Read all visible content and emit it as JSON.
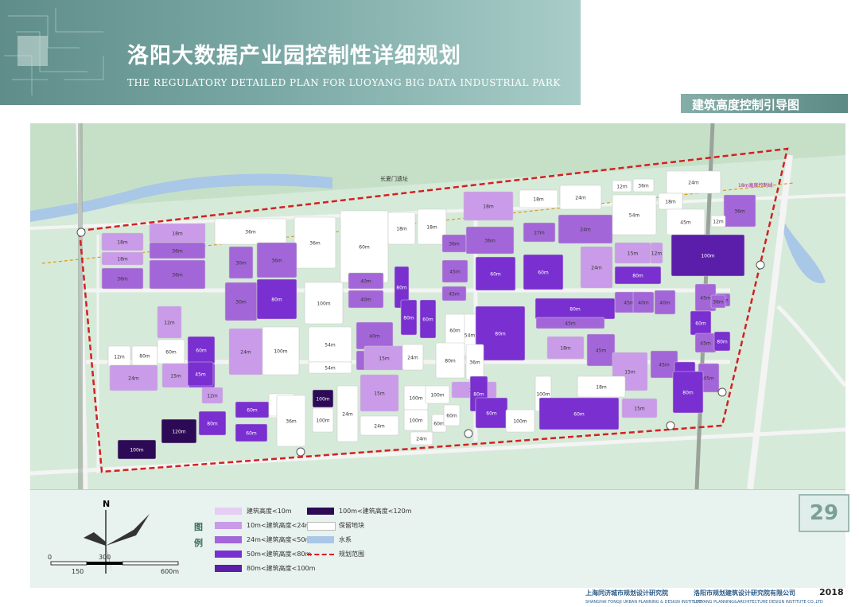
{
  "header": {
    "title_cn": "洛阳大数据产业园控制性详细规划",
    "title_en": "THE REGULATORY DETAILED PLAN FOR LUOYANG BIG DATA INDUSTRIAL PARK",
    "subtitle": "建筑高度控制引导图"
  },
  "map": {
    "road_label": "长夏门遗址",
    "line_label": "18m高度控制线",
    "colors": {
      "background": "#d6ead9",
      "road": "#f2f2f2",
      "water": "#a9c7e6",
      "reserved": "#ffffff",
      "boundary": "#d42020",
      "h1": "#e6cdf4",
      "h2": "#c99be8",
      "h3": "#a366d8",
      "h4": "#7a2fd0",
      "h5": "#5a1eaa",
      "h6": "#2c0a55"
    },
    "blocks": [
      {
        "label": "18m",
        "c": "h2"
      },
      {
        "label": "18m",
        "c": "h2"
      },
      {
        "label": "18m",
        "c": "h2"
      },
      {
        "label": "36m",
        "c": "h3"
      },
      {
        "label": "36m",
        "c": "h3"
      },
      {
        "label": "36m",
        "c": "h3"
      },
      {
        "label": "36m",
        "c": "reserved"
      },
      {
        "label": "60m",
        "c": "reserved"
      },
      {
        "label": "36m",
        "c": "reserved"
      },
      {
        "label": "18m",
        "c": "reserved"
      },
      {
        "label": "18m",
        "c": "reserved"
      },
      {
        "label": "18m",
        "c": "h2"
      },
      {
        "label": "36m",
        "c": "h3"
      },
      {
        "label": "36m",
        "c": "h3"
      },
      {
        "label": "18m",
        "c": "reserved"
      },
      {
        "label": "24m",
        "c": "reserved"
      },
      {
        "label": "27m",
        "c": "h3"
      },
      {
        "label": "24m",
        "c": "h3"
      },
      {
        "label": "12m",
        "c": "reserved"
      },
      {
        "label": "36m",
        "c": "reserved"
      },
      {
        "label": "54m",
        "c": "reserved"
      },
      {
        "label": "24m",
        "c": "reserved"
      },
      {
        "label": "18m",
        "c": "reserved"
      },
      {
        "label": "45m",
        "c": "reserved"
      },
      {
        "label": "36m",
        "c": "h3"
      },
      {
        "label": "12m",
        "c": "reserved"
      },
      {
        "label": "15m",
        "c": "h2"
      },
      {
        "label": "12m",
        "c": "h2"
      },
      {
        "label": "100m",
        "c": "h5"
      },
      {
        "label": "30m",
        "c": "h3"
      },
      {
        "label": "36m",
        "c": "h3"
      },
      {
        "label": "60m",
        "c": "h4"
      },
      {
        "label": "60m",
        "c": "h4"
      },
      {
        "label": "24m",
        "c": "h2"
      },
      {
        "label": "80m",
        "c": "h4"
      },
      {
        "label": "45m",
        "c": "h3"
      },
      {
        "label": "45m",
        "c": "h3"
      },
      {
        "label": "40m",
        "c": "h3"
      },
      {
        "label": "40m",
        "c": "h3"
      },
      {
        "label": "80m",
        "c": "h4"
      },
      {
        "label": "30m",
        "c": "h3"
      },
      {
        "label": "80m",
        "c": "h4"
      },
      {
        "label": "100m",
        "c": "reserved"
      },
      {
        "label": "40m",
        "c": "h3"
      },
      {
        "label": "40m",
        "c": "h3"
      },
      {
        "label": "54m",
        "c": "reserved"
      },
      {
        "label": "12m",
        "c": "h2"
      },
      {
        "label": "80m",
        "c": "h4"
      },
      {
        "label": "60m",
        "c": "reserved"
      },
      {
        "label": "45m",
        "c": "h3"
      },
      {
        "label": "80m",
        "c": "h4"
      },
      {
        "label": "45m",
        "c": "h3"
      },
      {
        "label": "40m",
        "c": "h3"
      },
      {
        "label": "40m",
        "c": "h3"
      },
      {
        "label": "36m",
        "c": "h3"
      },
      {
        "label": "45m",
        "c": "h3"
      },
      {
        "label": "36m",
        "c": "h3"
      },
      {
        "label": "60m",
        "c": "h4"
      },
      {
        "label": "45m",
        "c": "h3"
      },
      {
        "label": "80m",
        "c": "h4"
      },
      {
        "label": "60m",
        "c": "h4"
      },
      {
        "label": "12m",
        "c": "reserved"
      },
      {
        "label": "80m",
        "c": "reserved"
      },
      {
        "label": "60m",
        "c": "reserved"
      },
      {
        "label": "60m",
        "c": "h4"
      },
      {
        "label": "45m",
        "c": "h4"
      },
      {
        "label": "24m",
        "c": "h2"
      },
      {
        "label": "100m",
        "c": "reserved"
      },
      {
        "label": "54m",
        "c": "reserved"
      },
      {
        "label": "54m",
        "c": "reserved"
      },
      {
        "label": "15m",
        "c": "h2"
      },
      {
        "label": "24m",
        "c": "reserved"
      },
      {
        "label": "80m",
        "c": "reserved"
      },
      {
        "label": "36m",
        "c": "reserved"
      },
      {
        "label": "18m",
        "c": "h2"
      },
      {
        "label": "45m",
        "c": "h3"
      },
      {
        "label": "24m",
        "c": "h2"
      },
      {
        "label": "15m",
        "c": "h2"
      },
      {
        "label": "45m",
        "c": "h4"
      },
      {
        "label": "12m",
        "c": "h2"
      },
      {
        "label": "15m",
        "c": "h2"
      },
      {
        "label": "45m",
        "c": "h3"
      },
      {
        "label": "80m",
        "c": "h4"
      },
      {
        "label": "45m",
        "c": "h3"
      },
      {
        "label": "80m",
        "c": "h4"
      },
      {
        "label": "60m",
        "c": "h4"
      },
      {
        "label": "54m",
        "c": "reserved"
      },
      {
        "label": "24m",
        "c": "reserved"
      },
      {
        "label": "12m",
        "c": "reserved"
      },
      {
        "label": "36m",
        "c": "reserved"
      },
      {
        "label": "100m",
        "c": "h6"
      },
      {
        "label": "24m",
        "c": "reserved"
      },
      {
        "label": "15m",
        "c": "h2"
      },
      {
        "label": "100m",
        "c": "reserved"
      },
      {
        "label": "100m",
        "c": "reserved"
      },
      {
        "label": "12m",
        "c": "h2"
      },
      {
        "label": "80m",
        "c": "h4"
      },
      {
        "label": "100m",
        "c": "reserved"
      },
      {
        "label": "18m",
        "c": "reserved"
      },
      {
        "label": "15m",
        "c": "h2"
      },
      {
        "label": "100m",
        "c": "reserved"
      },
      {
        "label": "80m",
        "c": "h4"
      },
      {
        "label": "100m",
        "c": "h6"
      },
      {
        "label": "120m",
        "c": "h6"
      },
      {
        "label": "80m",
        "c": "h4"
      },
      {
        "label": "60m",
        "c": "h4"
      },
      {
        "label": "100m",
        "c": "reserved"
      },
      {
        "label": "24m",
        "c": "reserved"
      },
      {
        "label": "100m",
        "c": "reserved"
      },
      {
        "label": "24m",
        "c": "reserved"
      },
      {
        "label": "60m",
        "c": "reserved"
      },
      {
        "label": "60m",
        "c": "reserved"
      },
      {
        "label": "60m",
        "c": "h4"
      },
      {
        "label": "100m",
        "c": "reserved"
      },
      {
        "label": "60m",
        "c": "h4"
      },
      {
        "label": "80m",
        "c": "h4"
      }
    ]
  },
  "legend": {
    "title": "图\n例",
    "items": [
      {
        "label": "建筑高度<10m",
        "c": "h1"
      },
      {
        "label": "10m<建筑高度<24m",
        "c": "h2"
      },
      {
        "label": "24m<建筑高度<50m",
        "c": "h3"
      },
      {
        "label": "50m<建筑高度<80m",
        "c": "h4"
      },
      {
        "label": "80m<建筑高度<100m",
        "c": "h5"
      },
      {
        "label": "100m<建筑高度<120m",
        "c": "h6"
      },
      {
        "label": "保留地块",
        "c": "reserved"
      },
      {
        "label": "水系",
        "c": "water"
      },
      {
        "label": "规划范围",
        "c": "boundary"
      }
    ],
    "scale_labels": [
      "0",
      "300",
      "150",
      "600m"
    ],
    "north_label": "N"
  },
  "page_number": "29",
  "footer": {
    "org1_cn": "上海同济城市规划设计研究院",
    "org1_en": "SHANGHAI TONGJI URBAN PLANNING & DESIGN INSTITUTE",
    "org2_cn": "洛阳市规划建筑设计研究院有限公司",
    "org2_en": "LUOYANG PLANNING&ARCHITECTURE DESIGN INSTITUTE CO.,LTD",
    "year": "2018"
  }
}
